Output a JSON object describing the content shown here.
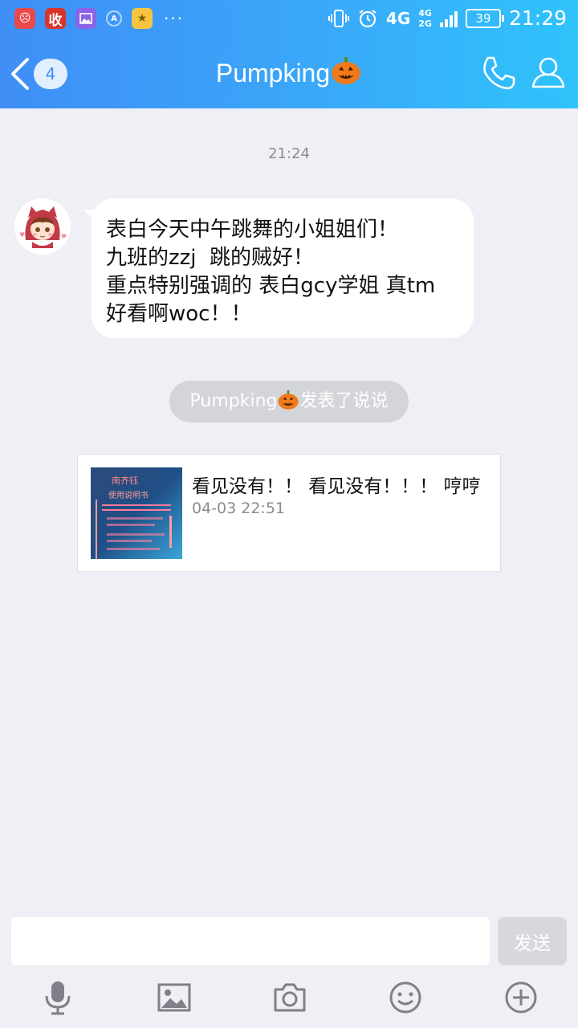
{
  "status_bar": {
    "time": "21:29",
    "battery": "39",
    "network_main": "4G",
    "network_small_top": "4G",
    "network_small_bottom": "2G",
    "notification_app_label": "收",
    "notification_app_sublabel": "",
    "more_dots": "···"
  },
  "header": {
    "title": "Pumpking",
    "unread_badge": "4"
  },
  "chat": {
    "time_stamp": "21:24",
    "message_lines": [
      "表白今天中午跳舞的小姐姐们！",
      "九班的zzj  跳的贼好！",
      "重点特别强调的 表白gcy学姐 真tm",
      "好看啊woc！！"
    ],
    "notice_name": "Pumpking",
    "notice_text": "发表了说说",
    "card": {
      "title": "看见没有！！ 看见没有！！！ 哼哼",
      "date": "04-03 22:51",
      "thumb_title": "南齐钰",
      "thumb_subtitle": "使用说明书"
    }
  },
  "input": {
    "value": "",
    "placeholder": "",
    "send_label": "发送"
  },
  "colors": {
    "header_gradient_start": "#3f8ef6",
    "header_gradient_end": "#2fc3fb",
    "background": "#eff0f5",
    "pumpkin": "#f07a1a"
  }
}
